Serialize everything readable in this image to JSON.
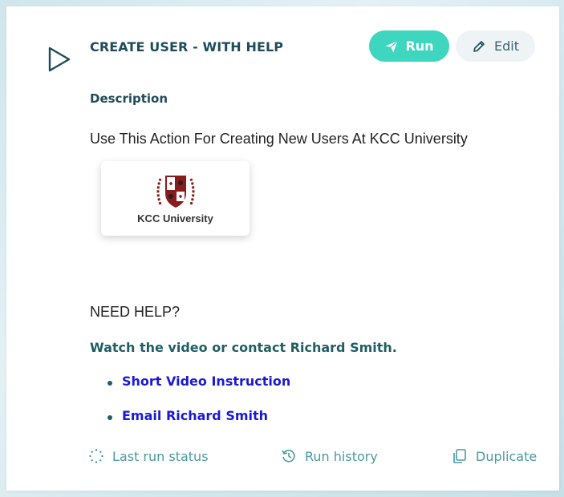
{
  "action": {
    "title": "CREATE USER - WITH HELP",
    "run_label": "Run",
    "edit_label": "Edit",
    "description_label": "Description",
    "description_text": "Use This Action For Creating New Users At KCC University"
  },
  "logo": {
    "text": "KCC University",
    "crest_icon": "shield-crest-icon"
  },
  "help": {
    "heading": "NEED HELP?",
    "subheading": "Watch the video or contact Richard Smith.",
    "links": [
      {
        "label": "Short Video Instruction"
      },
      {
        "label": "Email Richard Smith"
      }
    ]
  },
  "footer": {
    "last_run_status": "Last run status",
    "run_history": "Run history",
    "duplicate": "Duplicate"
  },
  "colors": {
    "accent": "#3ed6bf",
    "title": "#1f4c5a",
    "link": "#1a1ad6",
    "footer": "#4a9aa2"
  },
  "icons": [
    "play-icon",
    "send-icon",
    "pencil-icon",
    "loading-icon",
    "history-icon",
    "copy-icon"
  ]
}
